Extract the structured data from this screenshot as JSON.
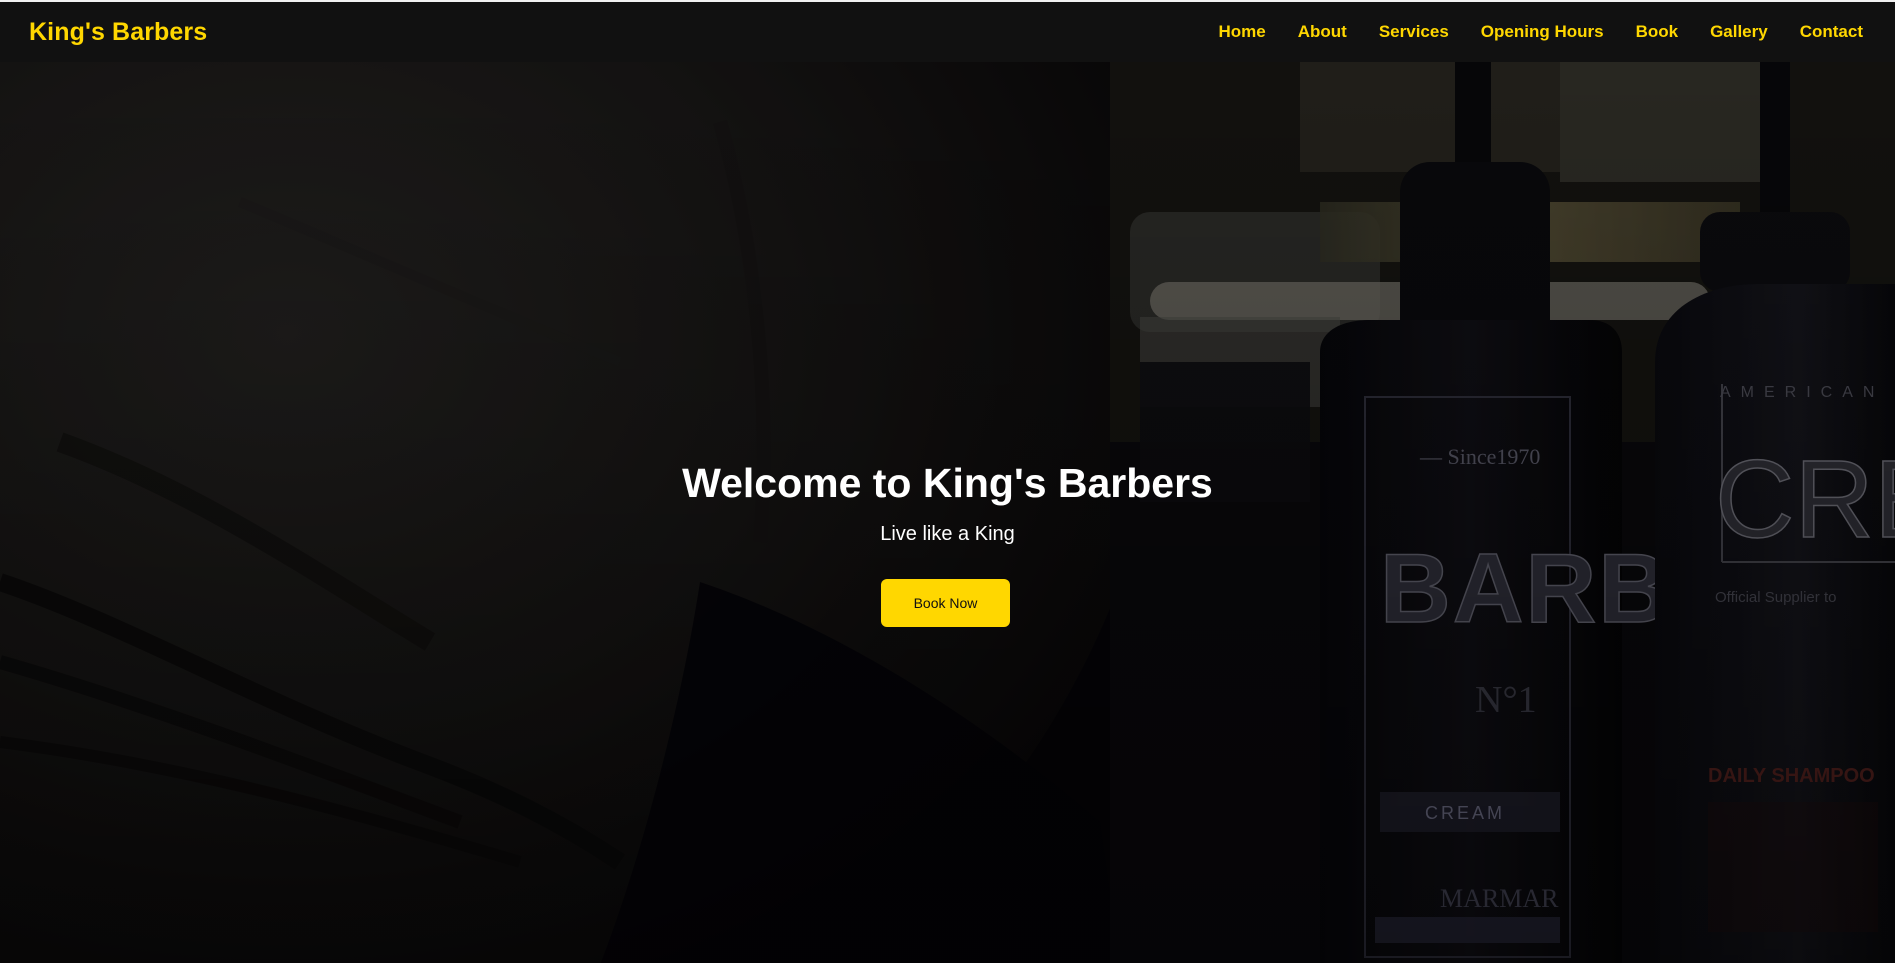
{
  "colors": {
    "accent": "#ffd700",
    "nav_background": "#111111",
    "hero_text": "#ffffff"
  },
  "navbar": {
    "brand": "King's Barbers",
    "links": [
      {
        "label": "Home"
      },
      {
        "label": "About"
      },
      {
        "label": "Services"
      },
      {
        "label": "Opening Hours"
      },
      {
        "label": "Book"
      },
      {
        "label": "Gallery"
      },
      {
        "label": "Contact"
      }
    ]
  },
  "hero": {
    "title": "Welcome to King's Barbers",
    "subtitle": "Live like a King",
    "cta_label": "Book Now",
    "background_image": {
      "label_text": [
        "Since1970",
        "BARB",
        "N°1",
        "CREAM",
        "MARMAR",
        "AMERICAN",
        "CREW",
        "Official Supplier to",
        "DAILY SHAMPOO"
      ]
    }
  }
}
